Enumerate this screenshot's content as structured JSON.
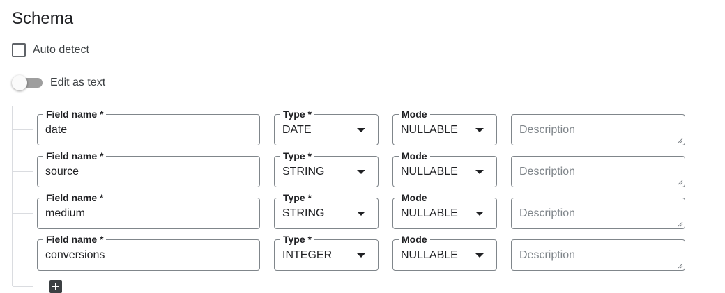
{
  "schema": {
    "title": "Schema",
    "auto_detect_label": "Auto detect",
    "auto_detect_checked": false,
    "edit_as_text_label": "Edit as text",
    "edit_as_text_on": false
  },
  "labels": {
    "field_name": "Field name *",
    "type": "Type *",
    "mode": "Mode",
    "description_placeholder": "Description"
  },
  "fields": [
    {
      "name": "date",
      "type": "DATE",
      "mode": "NULLABLE"
    },
    {
      "name": "source",
      "type": "STRING",
      "mode": "NULLABLE"
    },
    {
      "name": "medium",
      "type": "STRING",
      "mode": "NULLABLE"
    },
    {
      "name": "conversions",
      "type": "INTEGER",
      "mode": "NULLABLE"
    }
  ],
  "icons": {
    "add_field": "add-box-icon",
    "dropdown": "arrow-drop-down-icon"
  }
}
